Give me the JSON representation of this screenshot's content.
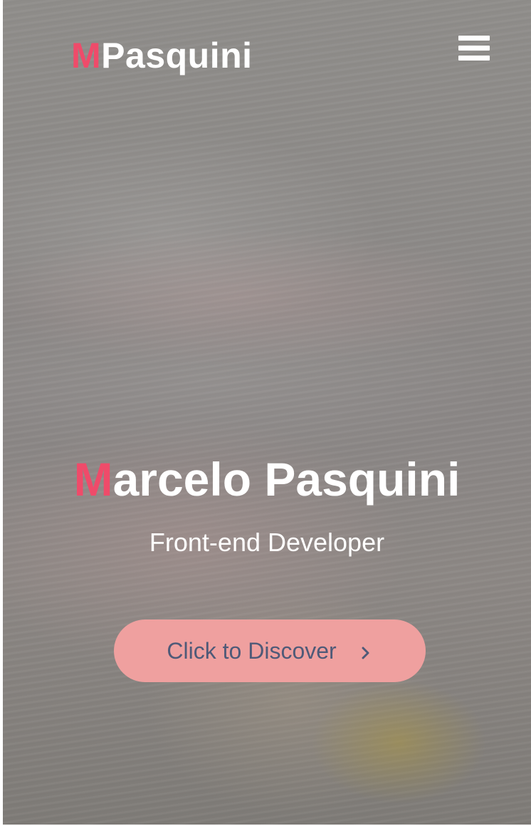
{
  "header": {
    "logo_accent": "M",
    "logo_rest": "Pasquini",
    "menu_icon": "hamburger-menu-icon"
  },
  "hero": {
    "title_accent": "M",
    "title_rest": "arcelo Pasquini",
    "subtitle": "Front-end Developer",
    "cta_label": "Click to Discover",
    "cta_icon": "chevron-right-icon"
  },
  "colors": {
    "accent": "#ef4b6a",
    "button_bg": "#efa09f",
    "button_text": "#4f5a78",
    "text": "#ffffff"
  }
}
